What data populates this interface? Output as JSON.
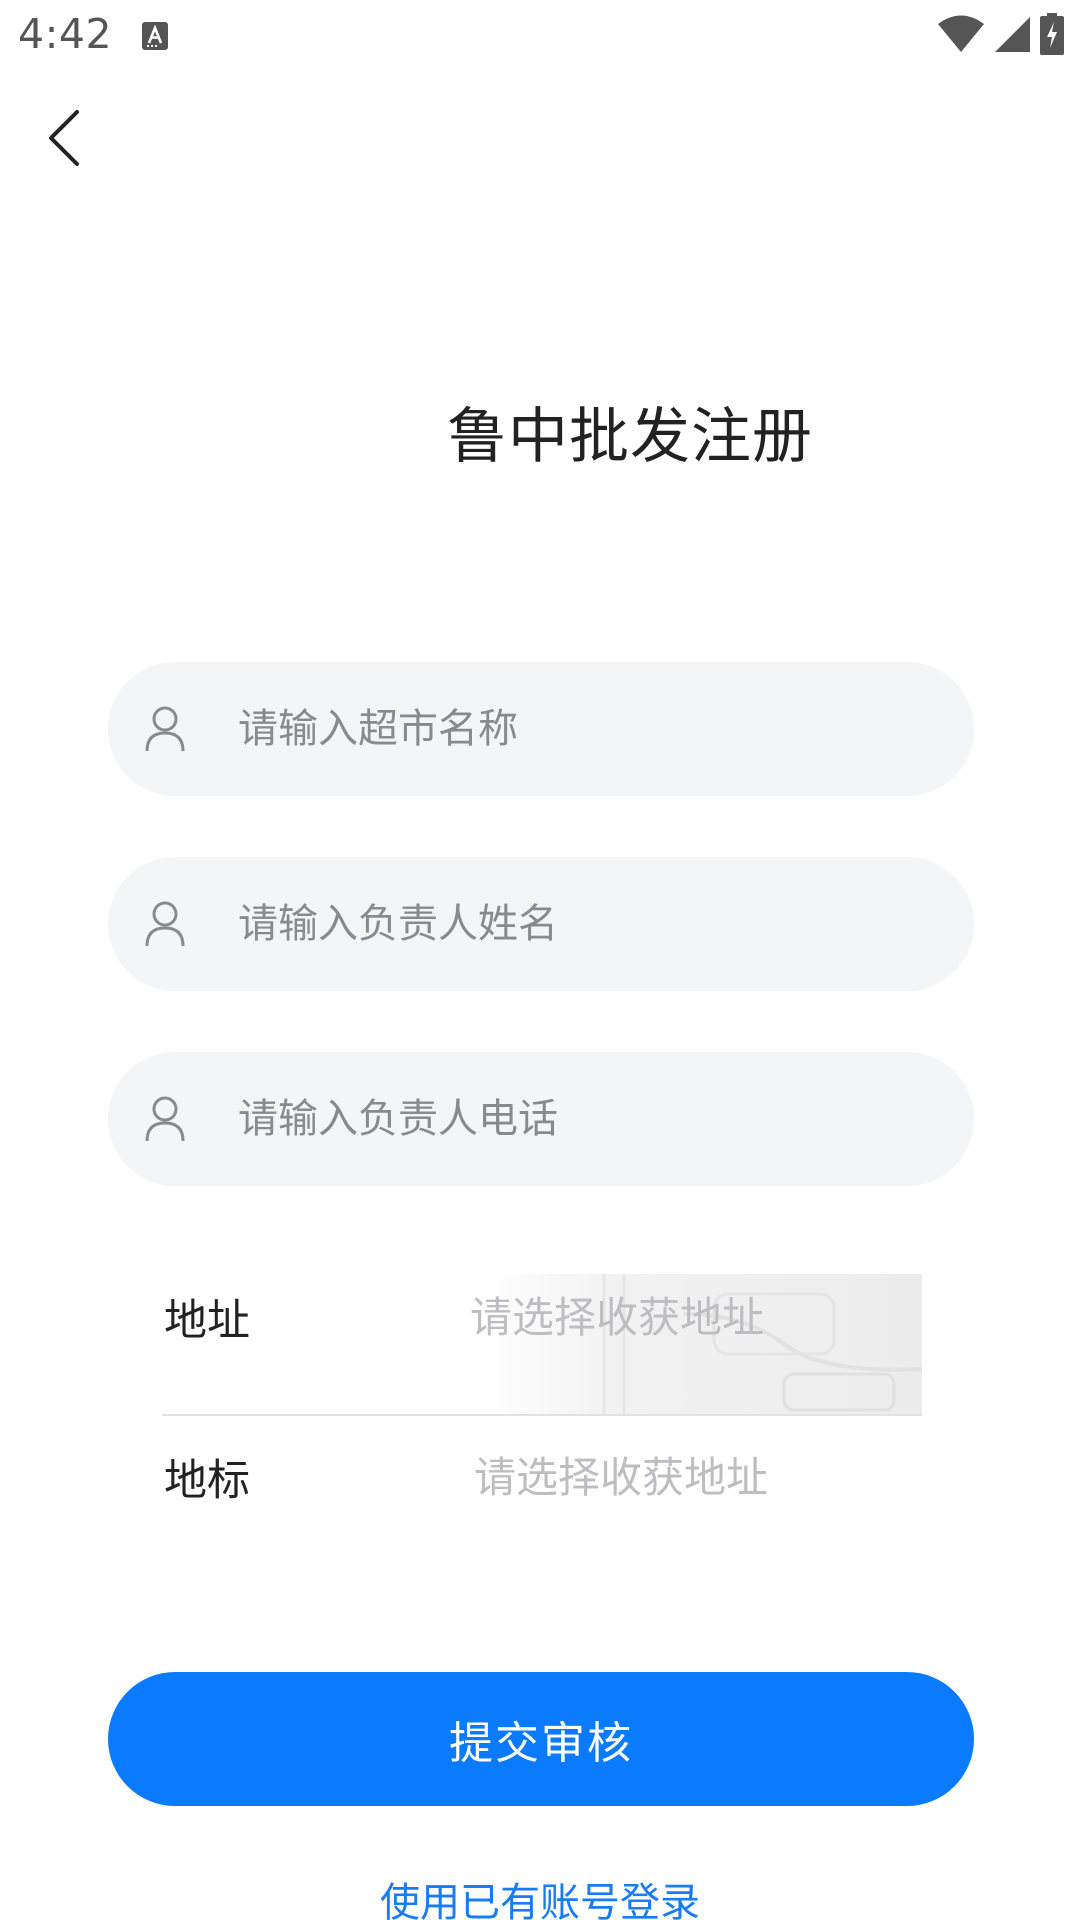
{
  "status_bar": {
    "time": "4:42"
  },
  "header": {
    "title": "鲁中批发注册"
  },
  "form": {
    "store_name_placeholder": "请输入超市名称",
    "contact_name_placeholder": "请输入负责人姓名",
    "contact_phone_placeholder": "请输入负责人电话",
    "address_label": "地址",
    "address_placeholder": "请选择收获地址",
    "landmark_label": "地标",
    "landmark_placeholder": "请选择收获地址"
  },
  "actions": {
    "submit_label": "提交审核",
    "login_link": "使用已有账号登录"
  },
  "colors": {
    "primary": "#0a7bff",
    "link": "#1a7cf5",
    "input_bg": "#f4f5f7",
    "placeholder": "#bdbdc2"
  },
  "icons": {
    "back": "chevron-left-icon",
    "field": "user-icon",
    "wifi": "wifi-icon",
    "signal": "signal-icon",
    "battery": "battery-charging-icon"
  }
}
